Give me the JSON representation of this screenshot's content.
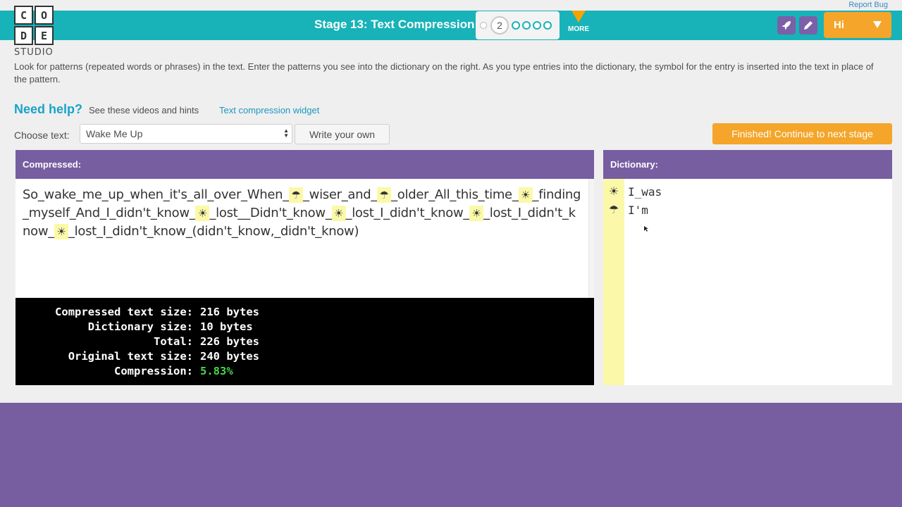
{
  "top": {
    "report_bug": "Report Bug"
  },
  "logo": {
    "letters": [
      "C",
      "O",
      "D",
      "E"
    ],
    "subtitle": "STUDIO"
  },
  "header": {
    "stage_title": "Stage 13: Text Compression",
    "current_level": "2",
    "more_label": "MORE",
    "user_label": "Hi",
    "icons": [
      "rocket-icon",
      "pencil-icon"
    ]
  },
  "instructions": "Look for patterns (repeated words or phrases) in the text. Enter the patterns you see into the dictionary on the right. As you type entries into the dictionary, the symbol for the entry is inserted into the text in place of the pattern.",
  "help": {
    "title": "Need help?",
    "subtitle": "See these videos and hints",
    "link": "Text compression widget"
  },
  "controls": {
    "choose_label": "Choose text:",
    "selected_text": "Wake Me Up",
    "write_own": "Write your own",
    "finish": "Finished! Continue to next stage"
  },
  "compressed": {
    "header": "Compressed:",
    "segments": [
      "So_wake_me_up_when_it's_all_over_When_",
      "☂",
      "_wiser_and_",
      "☂",
      "_older_All_this_time_",
      "☀",
      "_finding_myself_And_I_didn't_know_",
      "☀",
      "_lost__Didn't_know_",
      "☀",
      "_lost_I_didn't_know_",
      "☀",
      "_lost_I_didn't_know_",
      "☀",
      "_lost_I_didn't_know_(didn't_know,_didn't_know)"
    ]
  },
  "stats": {
    "rows": [
      {
        "label": "Compressed text size:",
        "value": "216 bytes"
      },
      {
        "label": "Dictionary size:",
        "value": "10 bytes"
      },
      {
        "label": "Total:",
        "value": "226 bytes"
      },
      {
        "label": "Original text size:",
        "value": "240 bytes"
      },
      {
        "label": "Compression:",
        "value": "5.83%"
      }
    ]
  },
  "dictionary": {
    "header": "Dictionary:",
    "entries": [
      {
        "symbol": "☀",
        "text": "I_was"
      },
      {
        "symbol": "☂",
        "text": "I'm"
      }
    ]
  },
  "colors": {
    "header_teal": "#17b3b8",
    "purple": "#775ea1",
    "orange": "#f4a52a",
    "highlight_yellow": "#fbf9a9",
    "compression_green": "#45d64e"
  }
}
